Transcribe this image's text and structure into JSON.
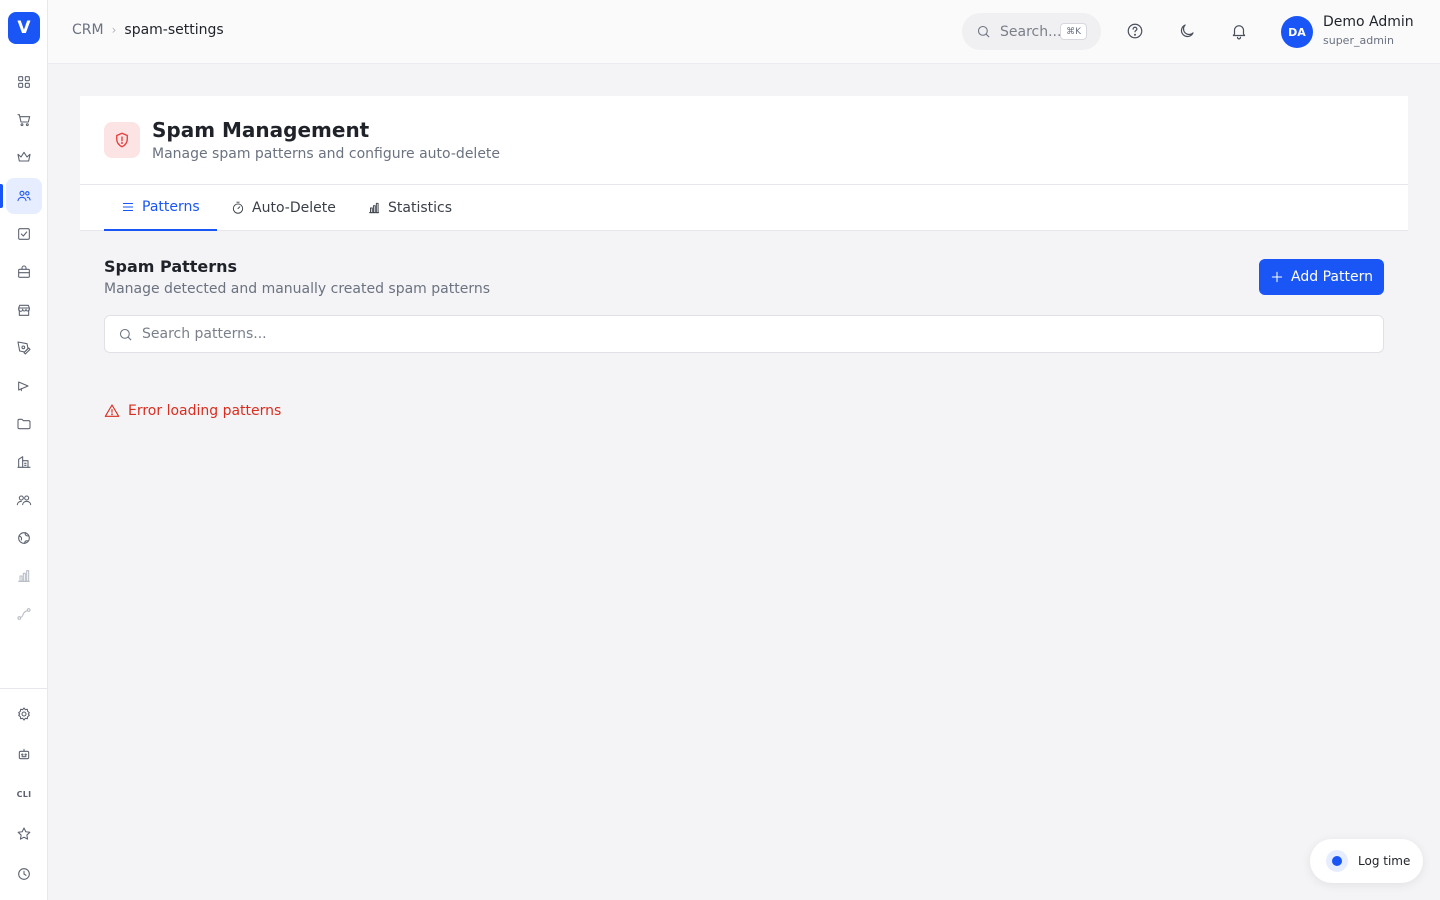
{
  "app": {
    "logo_letter": "V",
    "brand_color": "#1a55f5"
  },
  "sidebar": {
    "items": [
      {
        "name": "dashboard",
        "icon": "grid-icon"
      },
      {
        "name": "shop",
        "icon": "cart-icon"
      },
      {
        "name": "premium",
        "icon": "crown-icon"
      },
      {
        "name": "crm",
        "icon": "users-icon",
        "active": true
      },
      {
        "name": "tasks",
        "icon": "check-square-icon"
      },
      {
        "name": "products",
        "icon": "shopping-bag-icon"
      },
      {
        "name": "store",
        "icon": "store-icon"
      },
      {
        "name": "content",
        "icon": "pen-tool-icon"
      },
      {
        "name": "campaigns",
        "icon": "megaphone-icon"
      },
      {
        "name": "files",
        "icon": "folder-icon"
      },
      {
        "name": "companies",
        "icon": "building-icon"
      },
      {
        "name": "team",
        "icon": "team-icon"
      },
      {
        "name": "web",
        "icon": "globe-icon"
      },
      {
        "name": "analytics",
        "icon": "bar-chart-icon",
        "disabled": true
      },
      {
        "name": "workflows",
        "icon": "route-icon",
        "disabled": true
      }
    ],
    "bottom": [
      {
        "name": "settings",
        "icon": "gear-icon"
      },
      {
        "name": "bot",
        "icon": "robot-icon"
      },
      {
        "name": "cli",
        "label": "CLI"
      },
      {
        "name": "favorites",
        "icon": "star-icon"
      },
      {
        "name": "history",
        "icon": "clock-icon"
      }
    ]
  },
  "header": {
    "breadcrumb": {
      "root": "CRM",
      "current": "spam-settings"
    },
    "search": {
      "placeholder": "Search...",
      "shortcut": "⌘K"
    },
    "user": {
      "initials": "DA",
      "name": "Demo Admin",
      "role": "super_admin"
    }
  },
  "page": {
    "title": "Spam Management",
    "subtitle": "Manage spam patterns and configure auto-delete",
    "tabs": [
      {
        "label": "Patterns",
        "icon": "list-icon",
        "active": true
      },
      {
        "label": "Auto-Delete",
        "icon": "timer-icon"
      },
      {
        "label": "Statistics",
        "icon": "bar-chart-icon"
      }
    ]
  },
  "patterns": {
    "title": "Spam Patterns",
    "subtitle": "Manage detected and manually created spam patterns",
    "add_button": "Add Pattern",
    "search_placeholder": "Search patterns...",
    "error": "Error loading patterns"
  },
  "log_time": {
    "label": "Log time"
  },
  "colors": {
    "error": "#d92d20",
    "title_icon_bg": "#fde4e4",
    "title_icon_fg": "#e53e3e"
  }
}
